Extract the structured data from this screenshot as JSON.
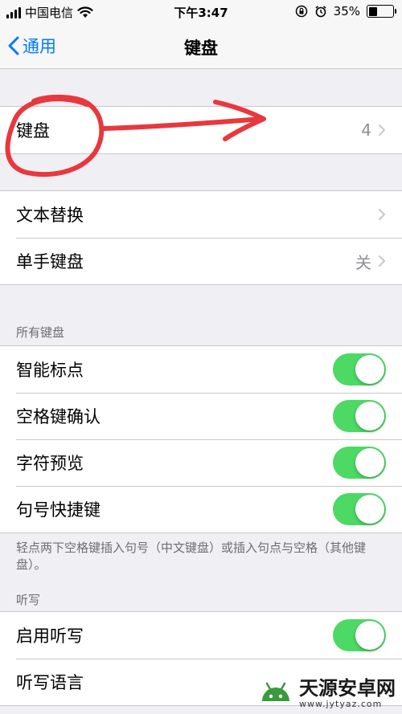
{
  "status": {
    "carrier": "中国电信",
    "time": "下午3:47",
    "battery_percent": "35%",
    "battery_level": 0.35
  },
  "nav": {
    "back_label": "通用",
    "title": "键盘"
  },
  "groups": {
    "keyboards": {
      "label": "键盘",
      "detail": "4"
    },
    "text_replace": {
      "label": "文本替换"
    },
    "one_hand": {
      "label": "单手键盘",
      "detail": "关"
    }
  },
  "all_keyboards": {
    "header": "所有键盘",
    "toggles": [
      {
        "label": "智能标点",
        "on": true
      },
      {
        "label": "空格键确认",
        "on": true
      },
      {
        "label": "字符预览",
        "on": true
      },
      {
        "label": "句号快捷键",
        "on": true
      }
    ],
    "footer": "轻点两下空格键插入句号（中文键盘）或插入句点与空格（其他键盘）。"
  },
  "dictation": {
    "header": "听写",
    "enable": {
      "label": "启用听写",
      "on": true
    },
    "language": {
      "label": "听写语言"
    }
  },
  "watermark": {
    "title": "天源安卓网",
    "url": "www.jytyaz.com"
  },
  "colors": {
    "accent": "#007aff",
    "toggle_on": "#4cd964",
    "annotation": "#e8383d"
  },
  "icons": [
    "signal-icon",
    "wifi-icon",
    "chevron-left-icon",
    "chevron-right-icon",
    "lock-rotation-icon",
    "alarm-icon",
    "battery-icon"
  ]
}
